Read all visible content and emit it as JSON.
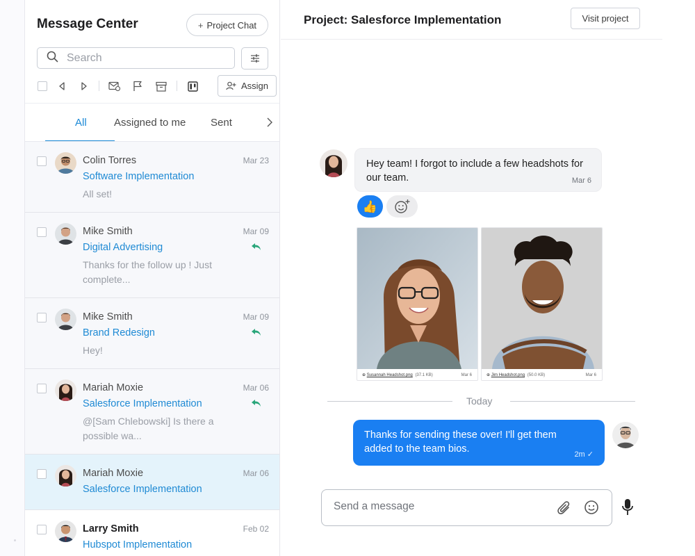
{
  "sidebar": {
    "title": "Message Center",
    "project_chat_label": "Project Chat",
    "search_placeholder": "Search",
    "assign_label": "Assign",
    "tabs": [
      {
        "label": "All",
        "active": true
      },
      {
        "label": "Assigned to me",
        "active": false
      },
      {
        "label": "Sent",
        "active": false
      }
    ],
    "threads": [
      {
        "name": "Colin Torres",
        "date": "Mar 23",
        "project": "Software Implementation",
        "preview": "All set!",
        "replied": false,
        "selected": false,
        "unread": false
      },
      {
        "name": "Mike Smith",
        "date": "Mar 09",
        "project": "Digital Advertising",
        "preview": "Thanks for the follow up ! Just complete...",
        "replied": true,
        "selected": false,
        "unread": false
      },
      {
        "name": "Mike Smith",
        "date": "Mar 09",
        "project": "Brand Redesign",
        "preview": "Hey!",
        "replied": true,
        "selected": false,
        "unread": false
      },
      {
        "name": "Mariah Moxie",
        "date": "Mar 06",
        "project": "Salesforce Implementation",
        "preview": "@[Sam Chlebowski] Is there a possible wa...",
        "replied": true,
        "selected": false,
        "unread": false
      },
      {
        "name": "Mariah Moxie",
        "date": "Mar 06",
        "project": "Salesforce Implementation",
        "preview": "",
        "replied": false,
        "selected": true,
        "unread": false
      },
      {
        "name": "Larry Smith",
        "date": "Feb 02",
        "project": "Hubspot Implementation",
        "preview": "",
        "replied": false,
        "selected": false,
        "unread": true
      }
    ]
  },
  "conversation": {
    "title": "Project: Salesforce Implementation",
    "visit_label": "Visit project",
    "incoming": {
      "text": "Hey team! I forgot to include a few headshots for our team.",
      "time": "Mar 6",
      "reaction_emoji": "👍"
    },
    "attachments": [
      {
        "filename": "Susannah Headshot.png",
        "size": "(37.1 KB)",
        "date": "Mar 6"
      },
      {
        "filename": "Jim Headshot.png",
        "size": "(50.0 KB)",
        "date": "Mar 6"
      }
    ],
    "divider_label": "Today",
    "outgoing": {
      "text": "Thanks for sending these over! I'll get them added to the team bios.",
      "time": "2m ✓"
    },
    "composer_placeholder": "Send a message"
  },
  "colors": {
    "accent": "#1a88d6",
    "bubble_out": "#1a7ff2",
    "selected_row": "#e4f3fb",
    "reply_icon": "#2aa67a"
  }
}
